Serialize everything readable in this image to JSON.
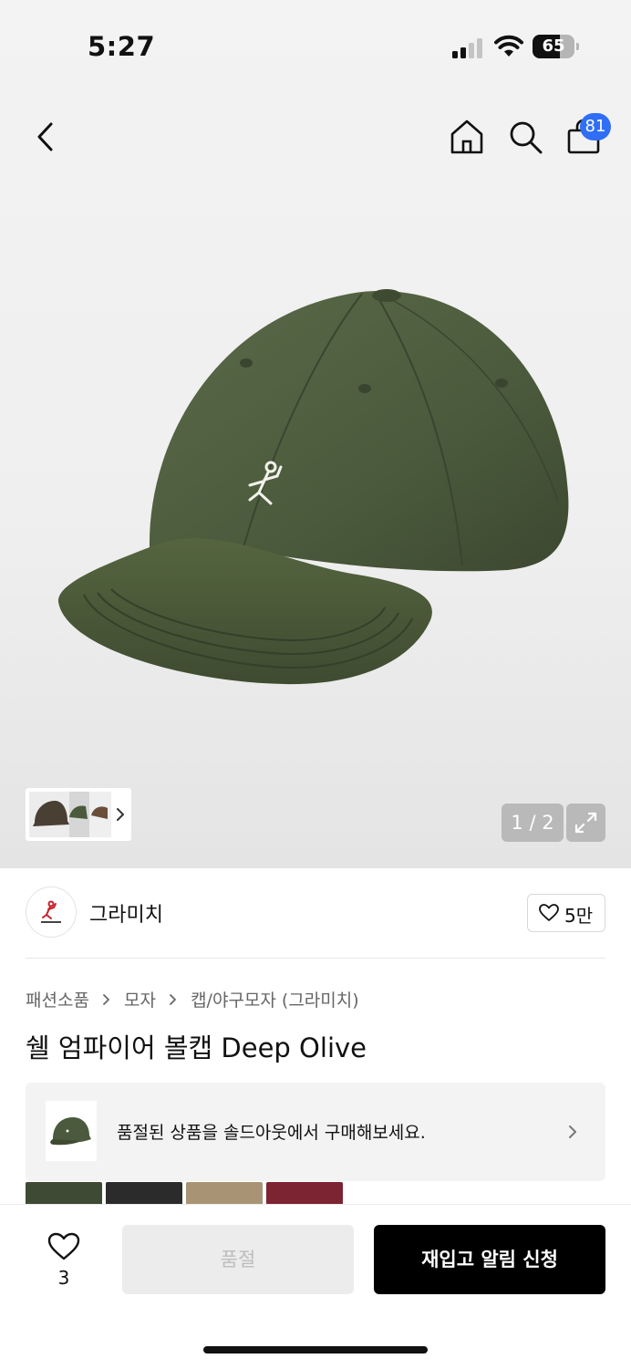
{
  "status_bar": {
    "time": "5:27",
    "battery_level": "65",
    "battery_fraction": 0.65
  },
  "header": {
    "cart_count": "81",
    "icons": [
      "back-icon",
      "home-icon",
      "search-icon",
      "shopping-bag-icon"
    ]
  },
  "gallery": {
    "page_indicator": "1 / 2",
    "thumbnail_next_icon": "chevron-right-icon",
    "expand_icon": "expand-icon"
  },
  "brand": {
    "name": "그라미치",
    "likes": "5만"
  },
  "breadcrumb": {
    "items": [
      "패션소품",
      "모자",
      "캡/야구모자 (그라미치)"
    ]
  },
  "product": {
    "title": "쉘 엄파이어 볼캡 Deep Olive"
  },
  "promo": {
    "text": "품절된 상품을 솔드아웃에서 구매해보세요."
  },
  "swatches": {
    "colors": [
      "#3e4a33",
      "#2b2b2b",
      "#a89474",
      "#7d2433"
    ]
  },
  "bottom_bar": {
    "wish_count": "3",
    "soldout_label": "품절",
    "restock_label": "재입고 알림 신청"
  },
  "colors": {
    "accent_badge": "#2f6ef5",
    "primary_button": "#000000",
    "cap_color": "#4b5a3c"
  }
}
